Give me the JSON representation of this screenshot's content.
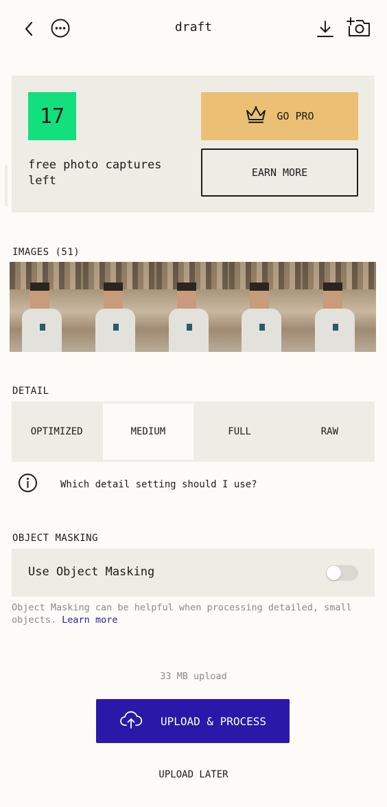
{
  "header": {
    "title": "draft",
    "icons": [
      "back-arrow-icon",
      "more-options-icon",
      "download-icon",
      "add-photo-icon"
    ]
  },
  "promo": {
    "captures_count": "17",
    "captures_text": "free photo captures left",
    "go_pro_label": "GO PRO",
    "earn_more_label": "EARN MORE",
    "counter_color": "#12E07E",
    "pro_color": "#EBC074"
  },
  "images": {
    "label": "IMAGES (51)"
  },
  "detail": {
    "label": "DETAIL",
    "options": [
      "OPTIMIZED",
      "MEDIUM",
      "FULL",
      "RAW"
    ],
    "selected": "MEDIUM",
    "help_text": "Which detail setting should I use?"
  },
  "masking": {
    "label": "OBJECT MASKING",
    "toggle_label": "Use Object Masking",
    "toggle_on": false,
    "description": "Object Masking can be helpful when processing detailed, small objects.",
    "learn_more": "Learn more"
  },
  "upload": {
    "size_text": "33 MB upload",
    "process_label": "UPLOAD & PROCESS",
    "later_label": "UPLOAD LATER",
    "accent_color": "#2A18A8"
  }
}
